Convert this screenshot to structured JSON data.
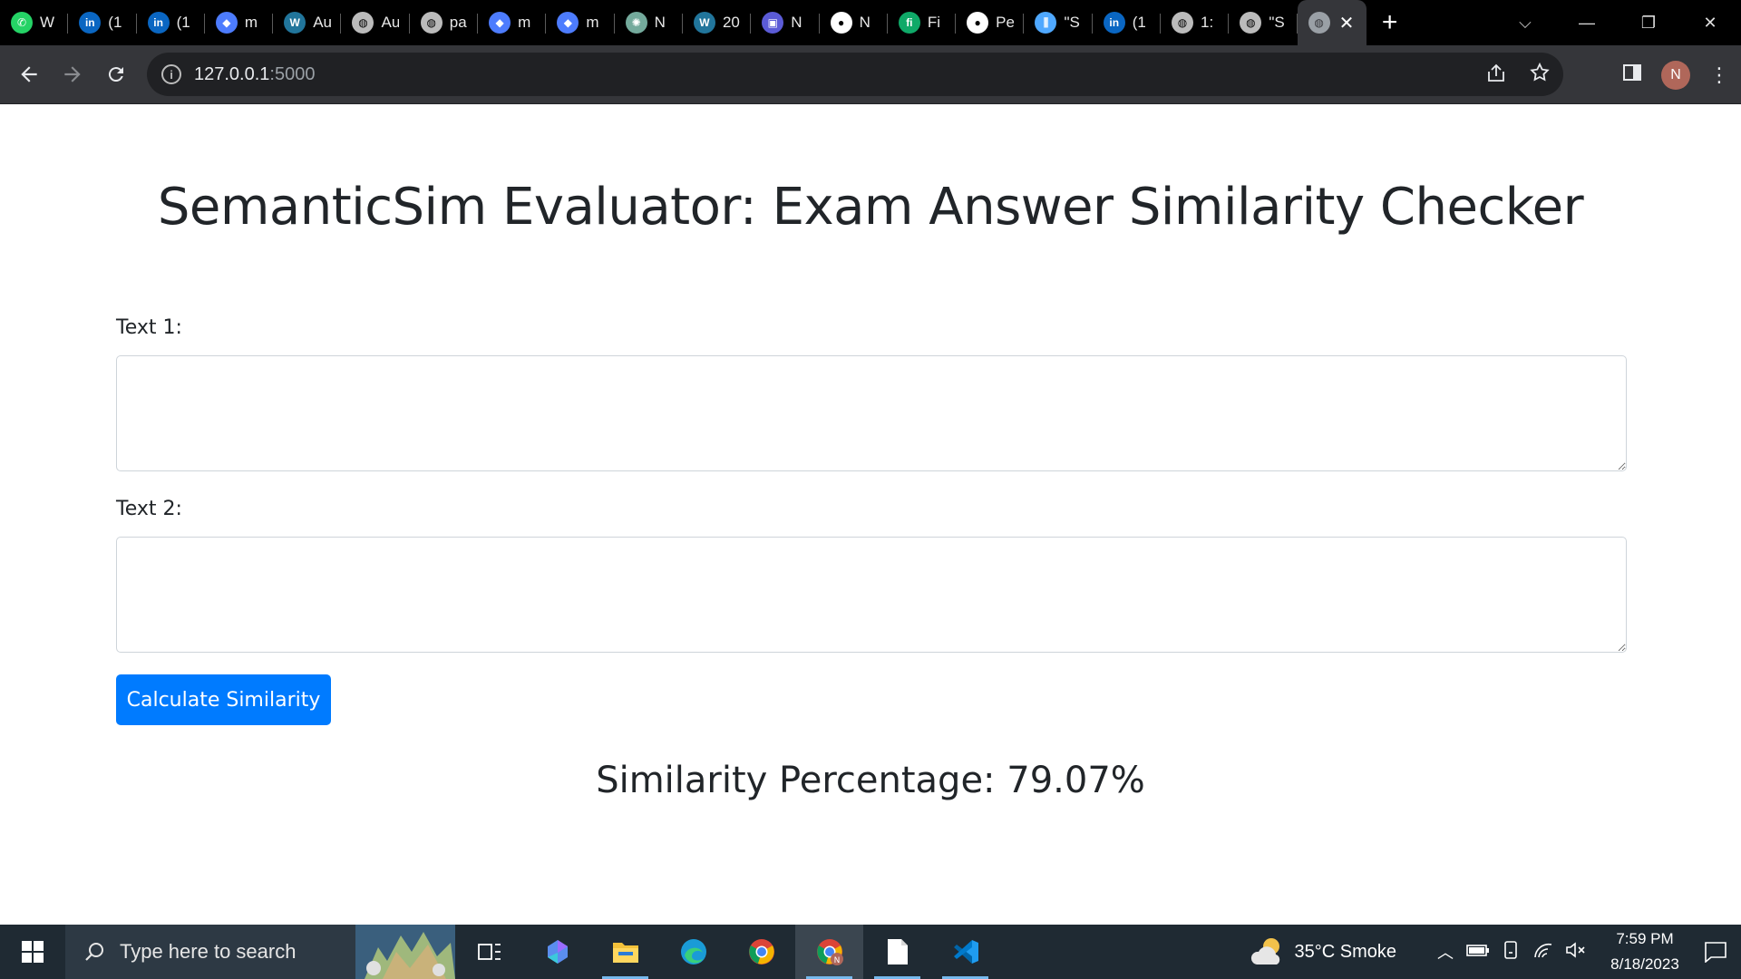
{
  "browser": {
    "tabs": [
      {
        "title": "W",
        "icon": "whatsapp-icon",
        "color": "#25d366"
      },
      {
        "title": "(1",
        "icon": "linkedin-icon",
        "color": "#0a66c2"
      },
      {
        "title": "(1",
        "icon": "linkedin-icon",
        "color": "#0a66c2"
      },
      {
        "title": "m",
        "icon": "graduation-cap-icon",
        "color": "#4d7cfe"
      },
      {
        "title": "Au",
        "icon": "wordpress-icon",
        "color": "#21759b"
      },
      {
        "title": "Au",
        "icon": "globe-icon",
        "color": "#bbbbbb"
      },
      {
        "title": "pa",
        "icon": "globe-icon",
        "color": "#bbbbbb"
      },
      {
        "title": "m",
        "icon": "graduation-cap-icon",
        "color": "#4d7cfe"
      },
      {
        "title": "m",
        "icon": "graduation-cap-icon",
        "color": "#4d7cfe"
      },
      {
        "title": "N",
        "icon": "chatgpt-icon",
        "color": "#74aa9c"
      },
      {
        "title": "20",
        "icon": "wordpress-icon",
        "color": "#21759b"
      },
      {
        "title": "N",
        "icon": "app-icon",
        "color": "#5b5bd6"
      },
      {
        "title": "N",
        "icon": "github-icon",
        "color": "#ffffff"
      },
      {
        "title": "Fi",
        "icon": "fi-icon",
        "color": "#0fa968"
      },
      {
        "title": "Pe",
        "icon": "github-icon",
        "color": "#ffffff"
      },
      {
        "title": "\"S",
        "icon": "columns-icon",
        "color": "#4fa8ff"
      },
      {
        "title": "(1",
        "icon": "linkedin-icon",
        "color": "#0a66c2"
      },
      {
        "title": "1:",
        "icon": "globe-icon",
        "color": "#bbbbbb"
      },
      {
        "title": "\"S",
        "icon": "globe-icon",
        "color": "#bbbbbb"
      }
    ],
    "active_tab_close": "✕",
    "new_tab": "+",
    "url_host": "127.0.0.1",
    "url_port": ":5000",
    "profile_initial": "N"
  },
  "page": {
    "title": "SemanticSim Evaluator: Exam Answer Similarity Checker",
    "text1_label": "Text 1:",
    "text2_label": "Text 2:",
    "text1_value": "",
    "text2_value": "",
    "button_label": "Calculate Similarity",
    "result": "Similarity Percentage: 79.07%",
    "accent": "#007bff"
  },
  "taskbar": {
    "search_placeholder": "Type here to search",
    "weather": "35°C  Smoke",
    "time": "7:59 PM",
    "date": "8/18/2023"
  }
}
